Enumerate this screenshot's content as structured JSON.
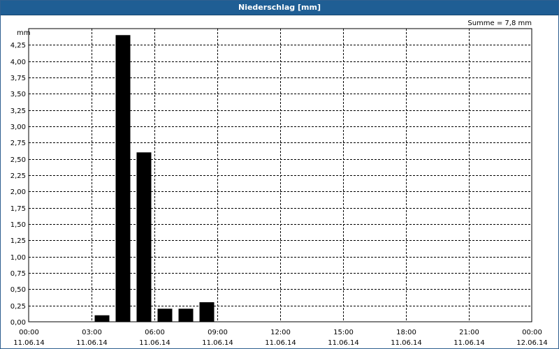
{
  "window": {
    "title": "Niederschlag [mm]"
  },
  "chart_data": {
    "type": "bar",
    "title": "Niederschlag [mm]",
    "annotation": "Summe = 7,8 mm",
    "ylabel": "mm",
    "xlabel": "",
    "ylim": [
      0,
      4.5
    ],
    "y_ticks": [
      "0,00",
      "0,25",
      "0,50",
      "0,75",
      "1,00",
      "1,25",
      "1,50",
      "1,75",
      "2,00",
      "2,25",
      "2,50",
      "2,75",
      "3,00",
      "3,25",
      "3,50",
      "3,75",
      "4,00",
      "4,25"
    ],
    "x_range_hours": [
      0,
      24
    ],
    "x_ticks": [
      {
        "time": "00:00",
        "date": "11.06.14"
      },
      {
        "time": "03:00",
        "date": "11.06.14"
      },
      {
        "time": "06:00",
        "date": "11.06.14"
      },
      {
        "time": "09:00",
        "date": "11.06.14"
      },
      {
        "time": "12:00",
        "date": "11.06.14"
      },
      {
        "time": "15:00",
        "date": "11.06.14"
      },
      {
        "time": "18:00",
        "date": "11.06.14"
      },
      {
        "time": "21:00",
        "date": "11.06.14"
      },
      {
        "time": "00:00",
        "date": "12.06.14"
      }
    ],
    "grid": true,
    "bar_color": "#000000",
    "series": [
      {
        "points": [
          {
            "x": "03:00–04:00",
            "value": 0.1
          },
          {
            "x": "04:00–05:00",
            "value": 4.4
          },
          {
            "x": "05:00–06:00",
            "value": 2.6
          },
          {
            "x": "06:00–07:00",
            "value": 0.2
          },
          {
            "x": "07:00–08:00",
            "value": 0.2
          },
          {
            "x": "08:00–09:00",
            "value": 0.3
          }
        ]
      }
    ]
  }
}
